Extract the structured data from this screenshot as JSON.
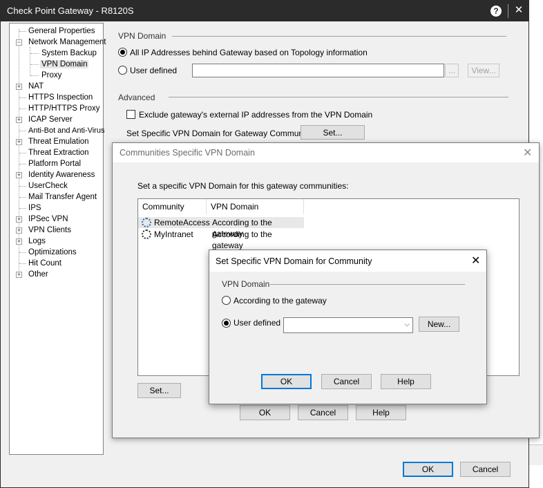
{
  "main_window": {
    "title": "Check Point Gateway - R8120S",
    "help_glyph": "?",
    "close_glyph": "✕",
    "ok_label": "OK",
    "cancel_label": "Cancel"
  },
  "tree": {
    "items": [
      {
        "label": "General Properties"
      },
      {
        "label": "Network Management"
      },
      {
        "label": "System Backup"
      },
      {
        "label": "VPN Domain"
      },
      {
        "label": "Proxy"
      },
      {
        "label": "NAT"
      },
      {
        "label": "HTTPS Inspection"
      },
      {
        "label": "HTTP/HTTPS Proxy"
      },
      {
        "label": "ICAP Server"
      },
      {
        "label": "Anti-Bot and Anti-Virus"
      },
      {
        "label": "Threat Emulation"
      },
      {
        "label": "Threat Extraction"
      },
      {
        "label": "Platform Portal"
      },
      {
        "label": "Identity Awareness"
      },
      {
        "label": "UserCheck"
      },
      {
        "label": "Mail Transfer Agent"
      },
      {
        "label": "IPS"
      },
      {
        "label": "IPSec VPN"
      },
      {
        "label": "VPN Clients"
      },
      {
        "label": "Logs"
      },
      {
        "label": "Optimizations"
      },
      {
        "label": "Hit Count"
      },
      {
        "label": "Other"
      }
    ],
    "expand_glyph": "+",
    "collapse_glyph": "−"
  },
  "vpn_domain": {
    "group_label": "VPN Domain",
    "radio_all_label": "All IP Addresses behind Gateway based on Topology information",
    "radio_user_label": "User defined",
    "user_value": "",
    "browse_label": "...",
    "view_label": "View..."
  },
  "advanced": {
    "group_label": "Advanced",
    "exclude_label": "Exclude gateway's external IP addresses from the VPN Domain",
    "communities_label": "Set Specific VPN Domain for Gateway Communities:",
    "set_label": "Set..."
  },
  "communities_dialog": {
    "title": "Communities Specific VPN Domain",
    "close_glyph": "✕",
    "instruction": "Set a specific VPN Domain for this gateway communities:",
    "columns": [
      "Community",
      "VPN Domain"
    ],
    "rows": [
      {
        "community": "RemoteAccess",
        "domain": "According to the gateway"
      },
      {
        "community": "MyIntranet",
        "domain": "According to the gateway"
      }
    ],
    "set_label": "Set...",
    "ok_label": "OK",
    "cancel_label": "Cancel",
    "help_label": "Help"
  },
  "specific_dialog": {
    "title": "Set Specific VPN Domain for Community",
    "close_glyph": "✕",
    "group_label": "VPN Domain",
    "radio_gateway_label": "According to the gateway",
    "radio_user_label": "User defined",
    "dropdown_value": "",
    "dropdown_glyph": "⌵",
    "new_label": "New...",
    "ok_label": "OK",
    "cancel_label": "Cancel",
    "help_label": "Help"
  },
  "colors": {
    "titlebar": "#2b2b2b",
    "accent": "#0078d7",
    "dialog_bg": "#f0f0f0"
  }
}
